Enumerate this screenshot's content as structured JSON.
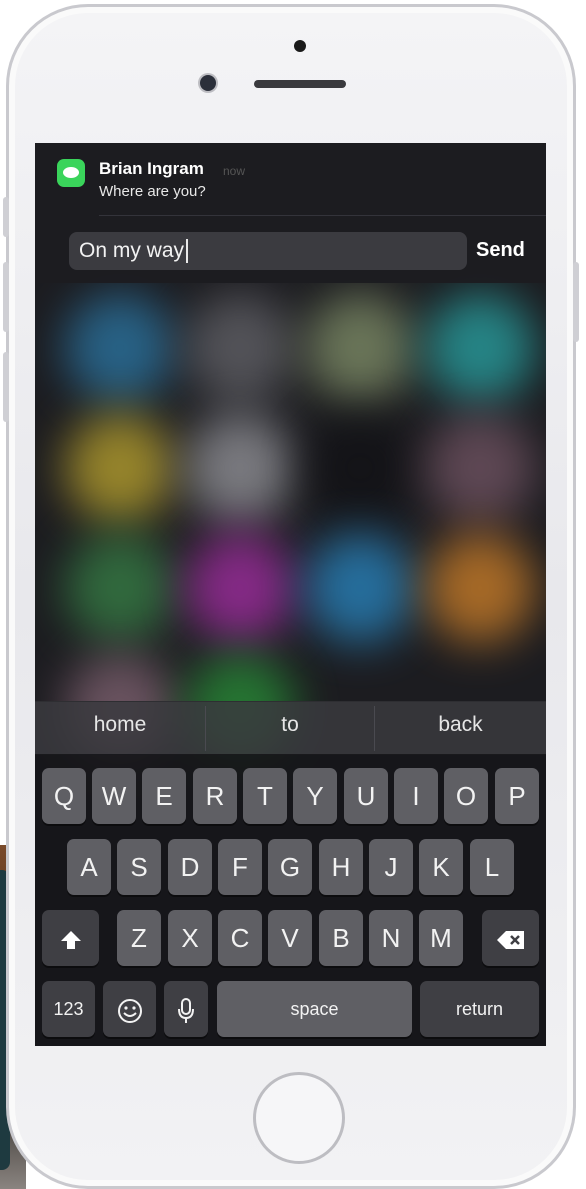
{
  "notification": {
    "app_icon": "messages-icon",
    "sender": "Brian Ingram",
    "time": "now",
    "message": "Where are you?"
  },
  "reply": {
    "input_value": "On my way",
    "send_label": "Send"
  },
  "suggestions": [
    "home",
    "to",
    "back"
  ],
  "keyboard": {
    "row1": [
      "Q",
      "W",
      "E",
      "R",
      "T",
      "Y",
      "U",
      "I",
      "O",
      "P"
    ],
    "row2": [
      "A",
      "S",
      "D",
      "F",
      "G",
      "H",
      "J",
      "K",
      "L"
    ],
    "row3": [
      "Z",
      "X",
      "C",
      "V",
      "B",
      "N",
      "M"
    ],
    "shift_icon": "shift-icon",
    "delete_icon": "delete-icon",
    "numbers_label": "123",
    "emoji_icon": "emoji-icon",
    "mic_icon": "microphone-icon",
    "space_label": "space",
    "return_label": "return"
  },
  "colors": {
    "messages_green": "#3ad45b",
    "key_fill": "#5f5f64",
    "key_dark_fill": "#3f3f44"
  }
}
